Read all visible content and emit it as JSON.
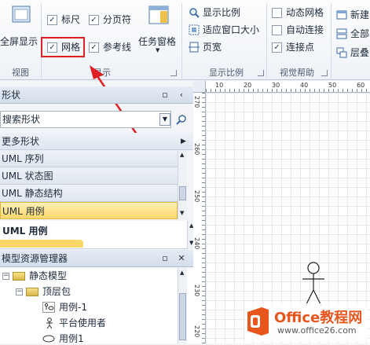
{
  "ribbon": {
    "view_group": {
      "label": "视图",
      "full_screen": "全屏显示"
    },
    "show_group": {
      "label": "显示",
      "ruler": {
        "label": "标尺",
        "checked": true
      },
      "page_break": {
        "label": "分页符",
        "checked": true
      },
      "grid": {
        "label": "网格",
        "checked": true
      },
      "guides": {
        "label": "参考线",
        "checked": true
      },
      "task_panes": "任务窗格"
    },
    "zoom_group": {
      "label": "显示比例",
      "zoom": "显示比例",
      "fit_window": "适应窗口大小",
      "page_width": "页宽"
    },
    "visual_aids_group": {
      "label": "视觉帮助",
      "dynamic_grid": {
        "label": "动态网格",
        "checked": false
      },
      "autoconnect": {
        "label": "自动连接",
        "checked": false
      },
      "connection_points": {
        "label": "连接点",
        "checked": true
      }
    },
    "window_group": {
      "new_window": "新建",
      "all": "全部",
      "cascade": "层叠"
    }
  },
  "shapes_panel": {
    "title": "形状",
    "search_placeholder": "搜索形状",
    "more_shapes": "更多形状",
    "stencils": [
      "UML 序列",
      "UML 状态图",
      "UML 静态结构",
      "UML 用例"
    ],
    "active_stencil_index": 3,
    "stencil_header": "UML 用例"
  },
  "model_explorer": {
    "title": "模型资源管理器",
    "items": [
      {
        "label": "静态模型",
        "toggle": "−"
      },
      {
        "label": "顶层包",
        "toggle": "−"
      },
      {
        "label": "用例-1"
      },
      {
        "label": "平台使用者"
      },
      {
        "label": "用例1"
      }
    ]
  },
  "ruler": {
    "h_labels": [
      "10",
      "20",
      "30",
      "40",
      "50",
      "60"
    ],
    "v_labels": [
      "270",
      "260",
      "250",
      "240",
      "230",
      "220"
    ]
  },
  "watermark": {
    "brand": "Office教程网",
    "url": "www.office26.com"
  },
  "colors": {
    "accent_orange": "#e8561e",
    "highlight_red": "#e02020",
    "active_yellow": "#fbd76a"
  }
}
